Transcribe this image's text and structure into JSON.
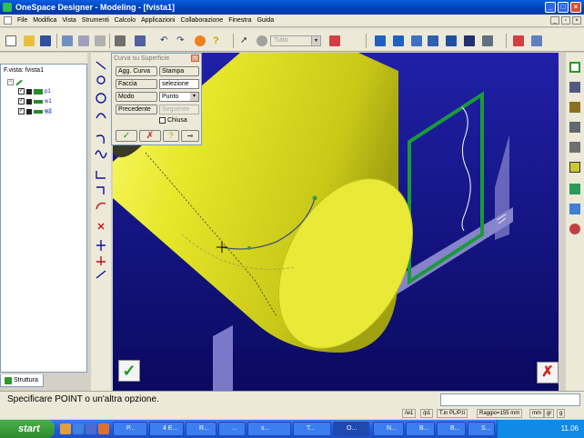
{
  "window": {
    "title": "OneSpace Designer - Modeling - [fvista1]"
  },
  "menu": [
    "File",
    "Modifica",
    "Vista",
    "Strumenti",
    "Calcolo",
    "Applicazioni",
    "Collaborazione",
    "Finestra",
    "Guida"
  ],
  "toolbar": {
    "filter_value": "Tutto"
  },
  "tree": {
    "root": "F.vista: fvista1",
    "items": [
      {
        "label": "p1",
        "checked": true
      },
      {
        "label": "w1",
        "checked": true
      },
      {
        "label": "w2",
        "checked": true
      }
    ],
    "tab_label": "Struttura"
  },
  "dialog": {
    "title": "Curva su Superficie",
    "add_curve_label": "Agg. Curva",
    "print_label": "Stampa",
    "face_label": "Faccia",
    "face_value": "selezione",
    "mode_label": "Modo",
    "mode_value": "Punto",
    "prev_label": "Precedente",
    "next_label": "Seguente",
    "closed_label": "Chiusa",
    "closed_checked": false
  },
  "status": {
    "prompt": "Specificare POINT o un'altra opzione.",
    "fields": [
      "/w1",
      "/p1",
      "T.in PL/P.ti",
      "Raggio=155 mm",
      "mm",
      "gr",
      "g"
    ]
  },
  "taskbar": {
    "start_label": "start",
    "tasks": [
      "P...",
      "4 E...",
      "R...",
      "...",
      "s...",
      "T...",
      "O...",
      "N...",
      "B...",
      "B...",
      "S..."
    ],
    "clock": "11.06"
  },
  "colors": {
    "viewport_top": "#2020a8",
    "viewport_bottom": "#0a0a60",
    "cylinder": "#e6e62a",
    "accent_green": "#1a9a3a"
  }
}
